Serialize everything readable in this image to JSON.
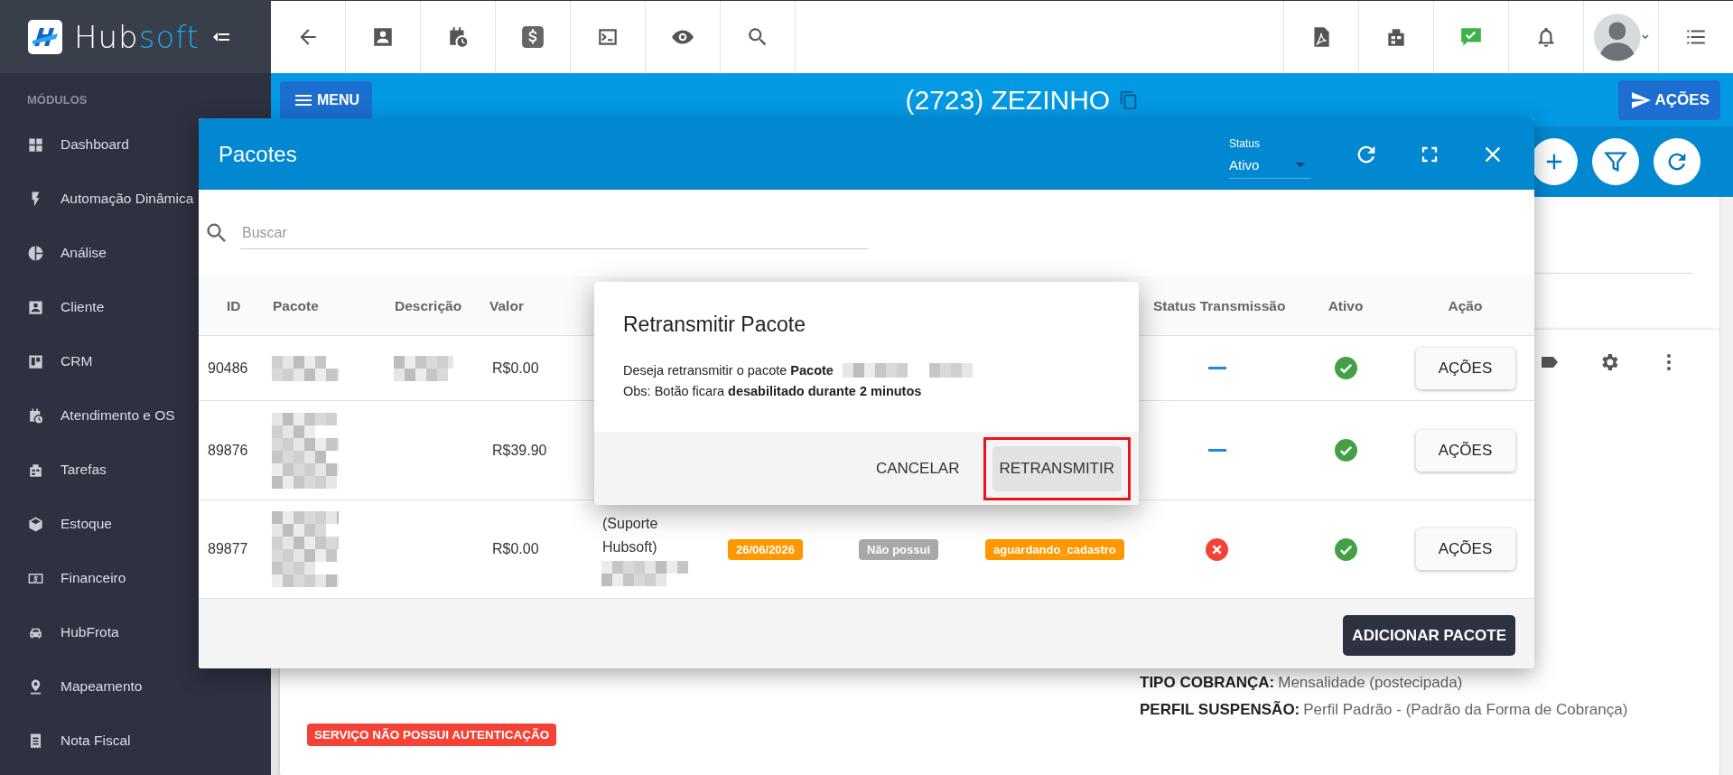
{
  "sidebar": {
    "logo": {
      "text": "Hub",
      "accent": "soft"
    },
    "section": "MÓDULOS",
    "items": [
      {
        "label": "Dashboard"
      },
      {
        "label": "Automação Dinâmica"
      },
      {
        "label": "Análise"
      },
      {
        "label": "Cliente"
      },
      {
        "label": "CRM"
      },
      {
        "label": "Atendimento e OS"
      },
      {
        "label": "Tarefas"
      },
      {
        "label": "Estoque"
      },
      {
        "label": "Financeiro"
      },
      {
        "label": "HubFrota"
      },
      {
        "label": "Mapeamento"
      },
      {
        "label": "Nota Fiscal"
      }
    ]
  },
  "header": {
    "menu_button": "MENU",
    "title": "(2723) ZEZINHO",
    "actions_button": "AÇÕES"
  },
  "modal": {
    "title": "Pacotes",
    "status_filter": {
      "label": "Status",
      "value": "Ativo"
    },
    "search": {
      "placeholder": "Buscar"
    },
    "table": {
      "columns": [
        "ID",
        "Pacote",
        "Descrição",
        "Valor",
        "Status Transmissão",
        "Ativo",
        "Ação"
      ],
      "rows": [
        {
          "id": "90486",
          "pacote_blur": true,
          "descricao_blur": true,
          "valor": "R$0.00",
          "transmission_failed": false,
          "ativo": true,
          "action": "AÇÕES"
        },
        {
          "id": "89876",
          "pacote_blur": true,
          "descricao_blur": false,
          "valor": "R$39.90",
          "transmission_failed": false,
          "ativo": true,
          "action": "AÇÕES"
        },
        {
          "id": "89877",
          "pacote_blur": true,
          "descricao_blur": false,
          "valor": "R$0.00",
          "column_5": "(Suporte Hubsoft)",
          "column_5_blur": true,
          "column_6": "26/06/2026",
          "column_7": "Não possui",
          "column_8": "aguardando_cadastro",
          "transmission_failed": true,
          "ativo": true,
          "action": "AÇÕES"
        }
      ]
    },
    "add_button": "ADICIONAR PACOTE"
  },
  "dialog": {
    "title": "Retransmitir Pacote",
    "message": "Deseja retransmitir o pacote **Pacote**",
    "message_blur": true,
    "note": "Obs: Botão ficara **desabilitado durante 2 minutos**",
    "cancel": "CANCELAR",
    "confirm": {
      "label": "RETRANSMITIR",
      "highlighted": true
    }
  },
  "details": {
    "lines": [
      {
        "label": "TIPO COBRANÇA:",
        "value": "Mensalidade (postecipada)"
      },
      {
        "label": "PERFIL SUSPENSÃO:",
        "value": "Perfil Padrão - (Padrão da Forma de Cobrança)"
      }
    ],
    "alert_badge": "SERVIÇO NÃO POSSUI AUTENTICAÇÃO"
  }
}
